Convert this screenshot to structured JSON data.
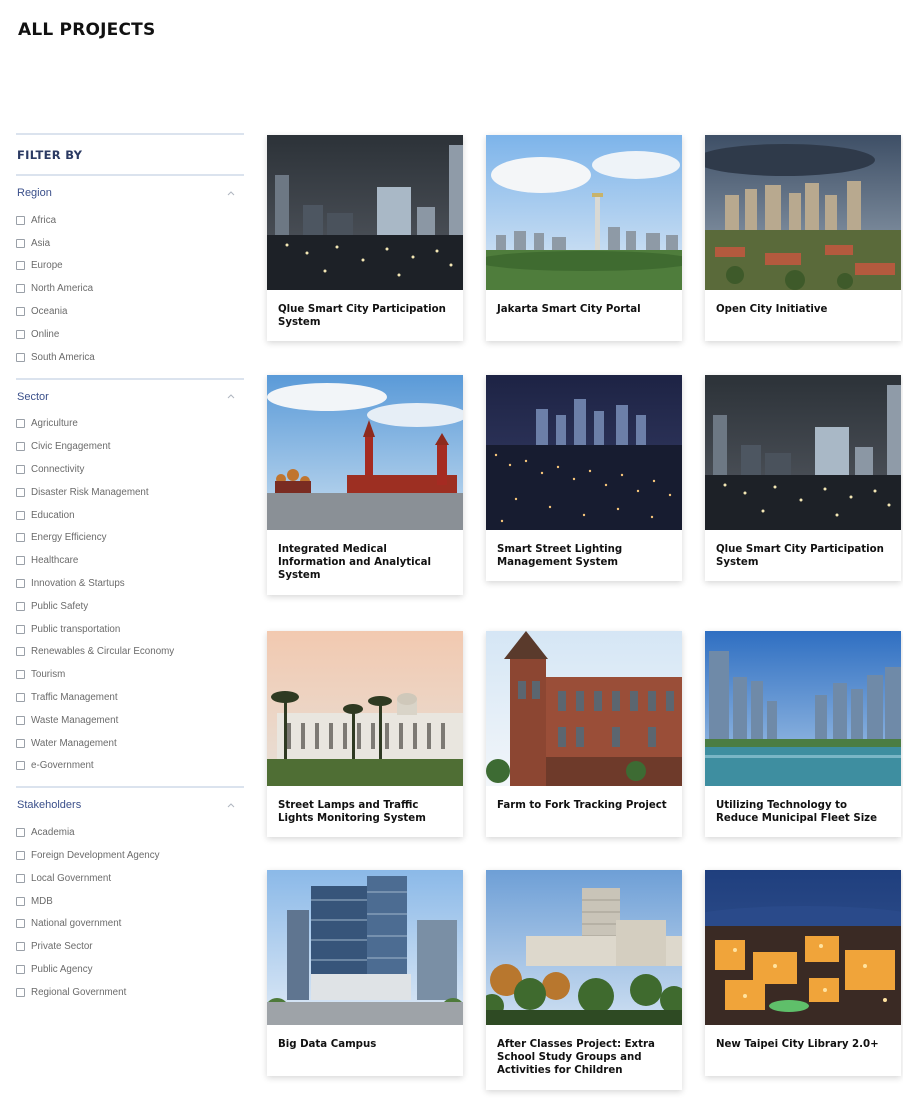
{
  "page": {
    "title": "ALL PROJECTS"
  },
  "filters": {
    "heading": "FILTER BY",
    "groups": [
      {
        "title": "Region",
        "options": [
          "Africa",
          "Asia",
          "Europe",
          "North America",
          "Oceania",
          "Online",
          "South America"
        ]
      },
      {
        "title": "Sector",
        "options": [
          "Agriculture",
          "Civic Engagement",
          "Connectivity",
          "Disaster Risk Management",
          "Education",
          "Energy Efficiency",
          "Healthcare",
          "Innovation & Startups",
          "Public Safety",
          "Public transportation",
          "Renewables & Circular Economy",
          "Tourism",
          "Traffic Management",
          "Waste Management",
          "Water Management",
          "e-Government"
        ]
      },
      {
        "title": "Stakeholders",
        "options": [
          "Academia",
          "Foreign Development Agency",
          "Local Government",
          "MDB",
          "National government",
          "Private Sector",
          "Public Agency",
          "Regional Government"
        ]
      }
    ]
  },
  "projects": [
    {
      "title": "Qlue Smart City Participation System",
      "image": "city-night-skyline"
    },
    {
      "title": "Jakarta Smart City Portal",
      "image": "jakarta-monument-skyline"
    },
    {
      "title": "Open City Initiative",
      "image": "city-aerial-dusk"
    },
    {
      "title": "Integrated Medical Information and Analytical System",
      "image": "red-square-kremlin"
    },
    {
      "title": "Smart Street Lighting Management System",
      "image": "city-lights-night"
    },
    {
      "title": "Qlue Smart City Participation System",
      "image": "city-night-skyline"
    },
    {
      "title": "Street Lamps and Traffic Lights Monitoring System",
      "image": "palm-colonial-building"
    },
    {
      "title": "Farm to Fork Tracking Project",
      "image": "red-brick-building"
    },
    {
      "title": "Utilizing Technology to Reduce Municipal Fleet Size",
      "image": "river-skyscrapers"
    },
    {
      "title": "Big Data Campus",
      "image": "glass-office-towers"
    },
    {
      "title": "After Classes Project: Extra School Study Groups and Activities for Children",
      "image": "campus-buildings-trees"
    },
    {
      "title": "New Taipei City Library 2.0+",
      "image": "taipei-night-aerial"
    }
  ]
}
